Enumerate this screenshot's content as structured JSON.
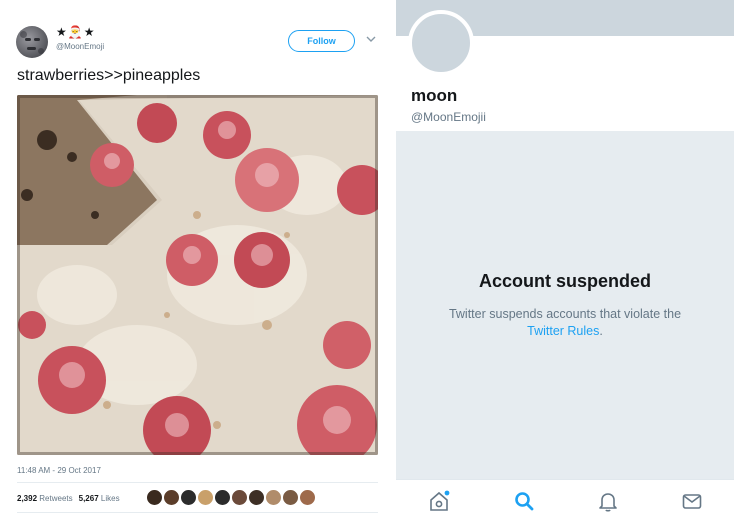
{
  "tweet": {
    "display_name": "★🎅★",
    "handle": "@MoonEmoji",
    "follow_label": "Follow",
    "text": "strawberries>>pineapples",
    "timestamp": "11:48 AM - 29 Oct 2017",
    "retweets_count": "2,392",
    "retweets_label": "Retweets",
    "likes_count": "5,267",
    "likes_label": "Likes",
    "liker_colors": [
      "#3a2a1f",
      "#5b3d2a",
      "#2c2c2c",
      "#c9a06a",
      "#2b2b2b",
      "#6b4a3a",
      "#3d2f25",
      "#b08c6a",
      "#7a5b43",
      "#9e6a4b"
    ]
  },
  "profile": {
    "name": "moon",
    "handle": "@MoonEmojii",
    "suspended_title": "Account suspended",
    "suspended_text": "Twitter suspends accounts that violate the",
    "rules_link": "Twitter Rules",
    "period": "."
  },
  "tabbar": {
    "items": [
      "home-icon",
      "search-icon",
      "notifications-icon",
      "messages-icon"
    ],
    "active": "search-icon"
  },
  "colors": {
    "accent": "#1da1f2",
    "secondary_text": "#657786",
    "suspended_bg": "#e6ecf0"
  }
}
